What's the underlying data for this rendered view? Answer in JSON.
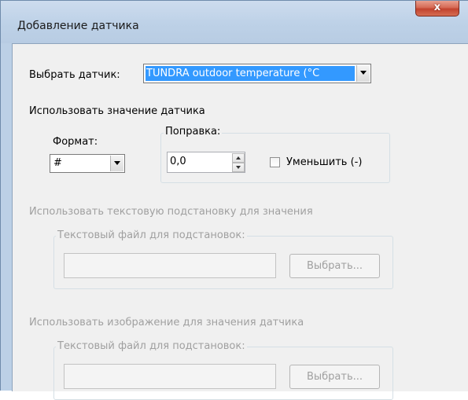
{
  "window": {
    "title": "Добавление датчика",
    "close_label": "x"
  },
  "sensor": {
    "label": "Выбрать датчик:",
    "selected": "TUNDRA outdoor temperature (°C"
  },
  "use_value_label": "Использовать значение датчика",
  "format": {
    "label": "Формат:",
    "selected": "#"
  },
  "correction": {
    "group_label": "Поправка:",
    "value": "0,0",
    "decrease_label": "Уменьшить (-)",
    "decrease_checked": false
  },
  "text_substitution": {
    "label": "Использовать текстовую подстановку для значения",
    "group_label": "Текстовый файл для подстановок:",
    "file_value": "",
    "browse_label": "Выбрать..."
  },
  "image_substitution": {
    "label": "Использовать изображение для значения датчика",
    "group_label": "Текстовый файл для подстановок:",
    "file_value": "",
    "browse_label": "Выбрать..."
  },
  "colors": {
    "selection": "#3399ff",
    "frame": "#bcd0e6",
    "disabled_text": "#a0a0a0"
  }
}
